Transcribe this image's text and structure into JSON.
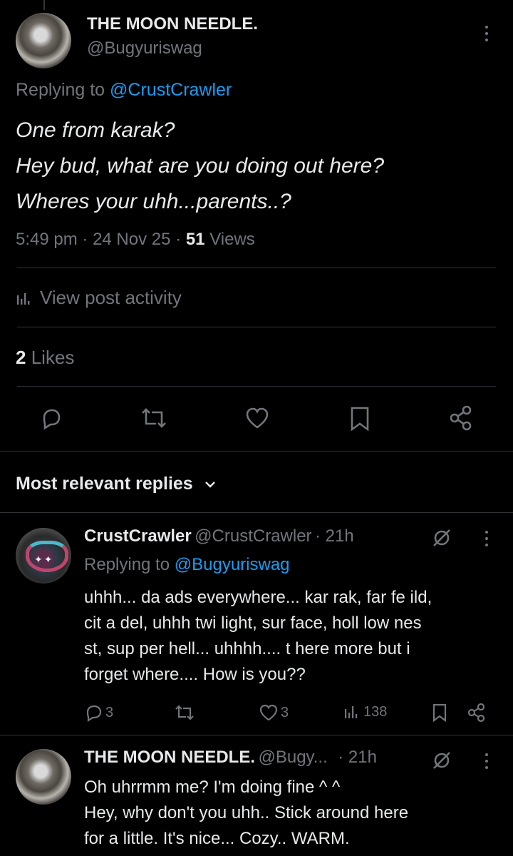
{
  "post": {
    "author_name": "THE MOON NEEDLE.",
    "author_handle": "@Bugyuriswag",
    "replying_prefix": "Replying to ",
    "replying_to": "@CrustCrawler",
    "lines": [
      "One from karak?",
      "Hey bud, what are you doing out here?",
      "Wheres your uhh...parents..?"
    ],
    "time": "5:49 pm",
    "date": "24 Nov 25",
    "views_count": "51",
    "views_label": "Views",
    "activity_label": "View post activity",
    "likes_count": "2",
    "likes_label": "Likes"
  },
  "replies_section": {
    "sort_label": "Most relevant replies"
  },
  "replies": [
    {
      "name": "CrustCrawler",
      "handle": "@CrustCrawler",
      "time": "· 21h",
      "replying_prefix": "Replying to ",
      "replying_to": "@Bugyuriswag",
      "lines": [
        "uhhh... da ads everywhere... kar rak, far fe ild,",
        "cit a del, uhhh twi light, sur face, holl low nes",
        "st, sup per hell... uhhhh.... t here more but i",
        "forget where.... How is you??"
      ],
      "reply_count": "3",
      "like_count": "3",
      "view_count": "138"
    },
    {
      "name": "THE MOON NEEDLE.",
      "handle": "@Bugy...",
      "time": "· 21h",
      "lines": [
        "Oh uhrrmm me? I'm doing fine ^ ^",
        "Hey, why don't you uhh.. Stick around here",
        "for a little. It's nice... Cozy.. WARM."
      ]
    }
  ],
  "icons": {
    "reply": "speech-bubble-icon",
    "repost": "repost-icon",
    "like": "heart-icon",
    "bookmark": "bookmark-icon",
    "share": "share-icon",
    "analytics": "bar-chart-icon",
    "grok": "grok-icon",
    "more": "kebab-icon",
    "chevron": "chevron-down-icon"
  },
  "colors": {
    "background": "#000000",
    "text": "#e7e9ea",
    "muted": "#71767b",
    "link": "#1d9bf0",
    "divider": "#2f3336"
  }
}
